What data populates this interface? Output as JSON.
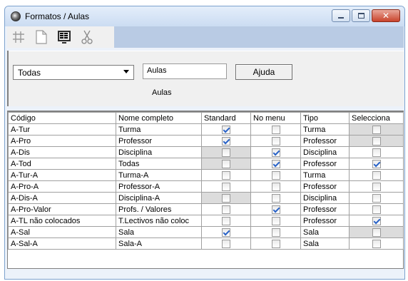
{
  "window": {
    "title": "Formatos / Aulas"
  },
  "toolbar": {
    "icons": [
      "grid-icon",
      "new-document-icon",
      "screen-icon",
      "cut-icon"
    ]
  },
  "filters": {
    "select_value": "Todas",
    "input_value": "Aulas",
    "help_label": "Ajuda",
    "caption": "Aulas"
  },
  "table": {
    "headers": [
      "Código",
      "Nome completo",
      "Standard",
      "No menu",
      "Tipo",
      "Selecciona"
    ],
    "rows": [
      {
        "code": "A-Tur",
        "name": "Turma",
        "standard": true,
        "standard_disabled": false,
        "menu": false,
        "menu_disabled": false,
        "type": "Turma",
        "select": false,
        "select_disabled": true
      },
      {
        "code": "A-Pro",
        "name": "Professor",
        "standard": true,
        "standard_disabled": false,
        "menu": false,
        "menu_disabled": false,
        "type": "Professor",
        "select": false,
        "select_disabled": true
      },
      {
        "code": "A-Dis",
        "name": "Disciplina",
        "standard": false,
        "standard_disabled": true,
        "menu": true,
        "menu_disabled": false,
        "type": "Disciplina",
        "select": false,
        "select_disabled": false
      },
      {
        "code": "A-Tod",
        "name": "Todas",
        "standard": false,
        "standard_disabled": true,
        "menu": true,
        "menu_disabled": false,
        "type": "Professor",
        "select": true,
        "select_disabled": false
      },
      {
        "code": "A-Tur-A",
        "name": "Turma-A",
        "standard": false,
        "standard_disabled": false,
        "menu": false,
        "menu_disabled": false,
        "type": "Turma",
        "select": false,
        "select_disabled": false
      },
      {
        "code": "A-Pro-A",
        "name": "Professor-A",
        "standard": false,
        "standard_disabled": false,
        "menu": false,
        "menu_disabled": false,
        "type": "Professor",
        "select": false,
        "select_disabled": false
      },
      {
        "code": "A-Dis-A",
        "name": "Disciplina-A",
        "standard": false,
        "standard_disabled": true,
        "menu": false,
        "menu_disabled": false,
        "type": "Disciplina",
        "select": false,
        "select_disabled": false
      },
      {
        "code": "A-Pro-Valor",
        "name": "Profs. / Valores",
        "standard": false,
        "standard_disabled": false,
        "menu": true,
        "menu_disabled": false,
        "type": "Professor",
        "select": false,
        "select_disabled": false
      },
      {
        "code": "A-TL não colocados",
        "name": "T.Lectivos não coloc",
        "standard": false,
        "standard_disabled": false,
        "menu": false,
        "menu_disabled": false,
        "type": "Professor",
        "select": true,
        "select_disabled": false
      },
      {
        "code": "A-Sal",
        "name": "Sala",
        "standard": true,
        "standard_disabled": false,
        "menu": false,
        "menu_disabled": false,
        "type": "Sala",
        "select": false,
        "select_disabled": true
      },
      {
        "code": "A-Sal-A",
        "name": "Sala-A",
        "standard": false,
        "standard_disabled": false,
        "menu": false,
        "menu_disabled": false,
        "type": "Sala",
        "select": false,
        "select_disabled": false
      }
    ]
  }
}
